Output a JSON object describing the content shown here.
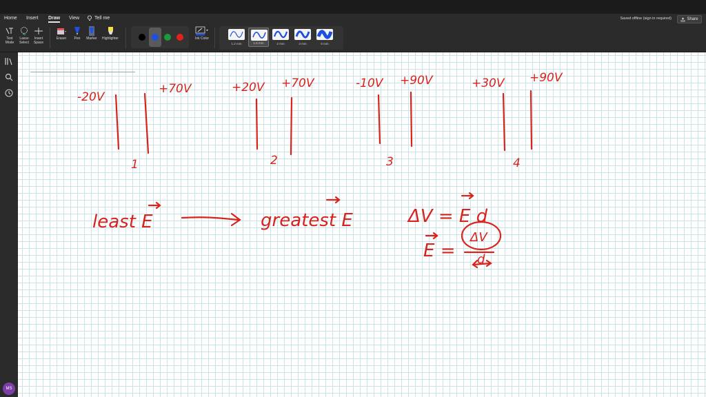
{
  "menubar": {
    "tabs": [
      {
        "label": "Home"
      },
      {
        "label": "Insert"
      },
      {
        "label": "Draw"
      },
      {
        "label": "View"
      },
      {
        "label": "Tell me"
      }
    ],
    "active_tab": "Draw",
    "status": "Saved offline (sign in required)",
    "share_label": "Share"
  },
  "ribbon": {
    "text_mode": "Text Mode",
    "lasso_select": "Lasso Select",
    "insert_space": "Insert Space",
    "eraser": "Eraser",
    "pen": "Pen",
    "marker": "Marker",
    "highlighter": "Highlighter",
    "ink_color": "Ink Color",
    "colors": [
      "#000000",
      "#1f4fe0",
      "#1a9a3a",
      "#e0221a"
    ],
    "selected_color": "#1f4fe0",
    "thickness": [
      "1.2 mm",
      "1.5 mm",
      "2 mm",
      "3 mm",
      "6 mm"
    ],
    "selected_thickness": "1.5 mm"
  },
  "rail": {
    "icons": [
      "library-icon",
      "search-icon",
      "history-icon"
    ],
    "avatar_initials": "MS"
  },
  "ink": {
    "color": "#d8231c",
    "plates": [
      {
        "left_v": "-20V",
        "right_v": "+70V",
        "number": "1"
      },
      {
        "left_v": "+20V",
        "right_v": "+70V",
        "number": "2"
      },
      {
        "left_v": "-10V",
        "right_v": "+90V",
        "number": "3"
      },
      {
        "left_v": "+30V",
        "right_v": "+90V",
        "number": "4"
      }
    ],
    "least": "least E",
    "greatest": "greatest E",
    "eq1": "ΔV = E d",
    "eq2_lhs": "E =",
    "eq2_num": "ΔV",
    "eq2_den": "d"
  }
}
